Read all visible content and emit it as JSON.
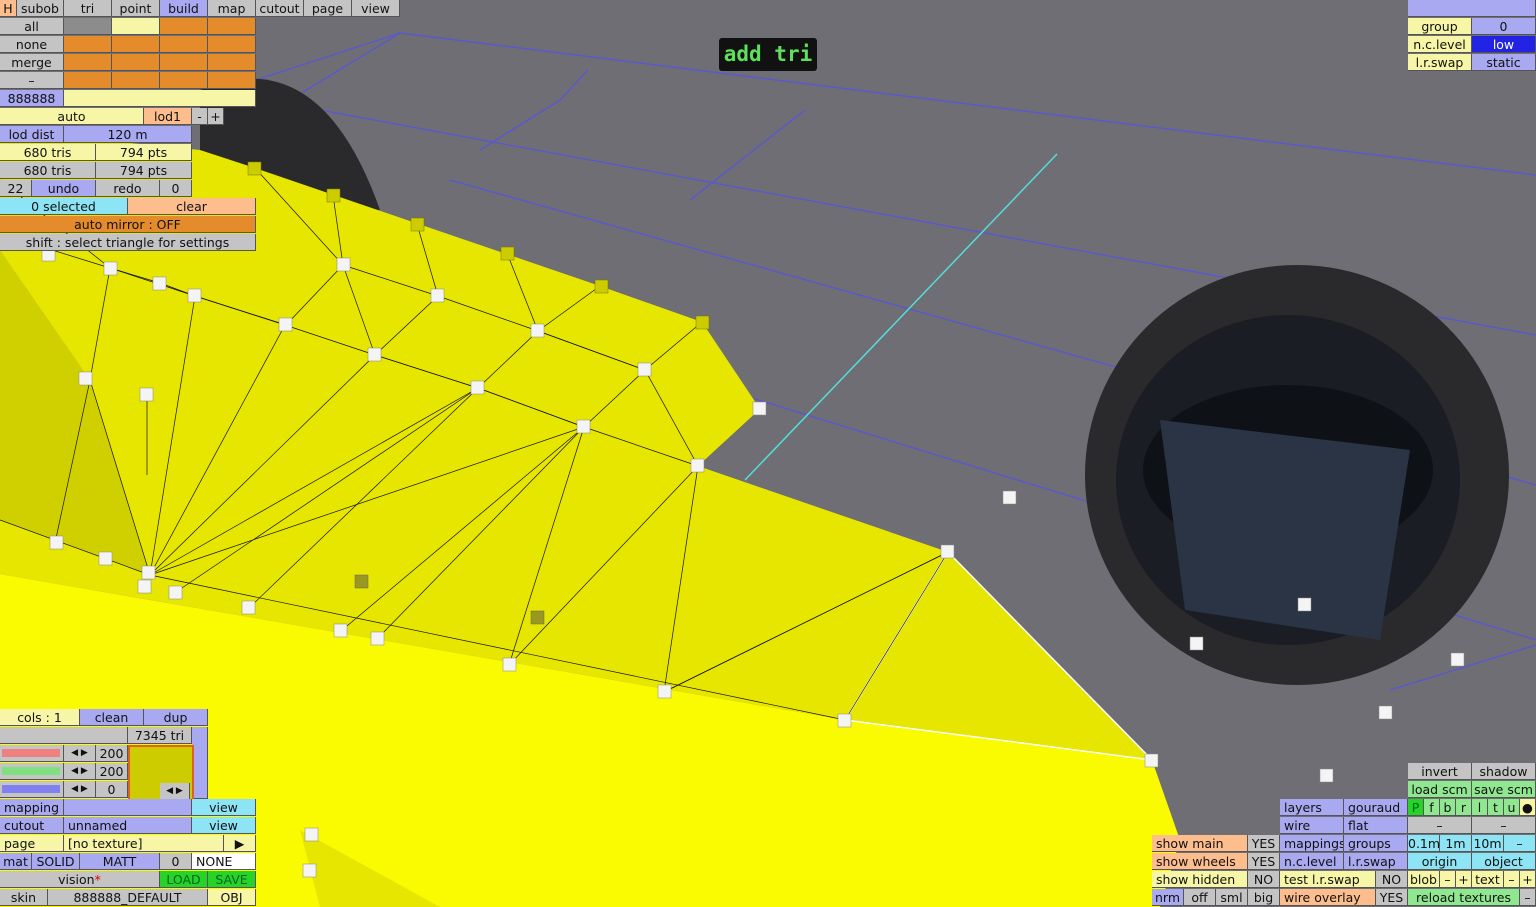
{
  "scene": {
    "bg_color": "#6e6e74",
    "mesh_color": "#e6e600",
    "handle": "vertex-handle"
  },
  "banner": "add tri",
  "tabs": {
    "h": "H",
    "subob": "subob",
    "tri": "tri",
    "point": "point",
    "build": "build",
    "map": "map",
    "cutout": "cutout",
    "page": "page",
    "view": "view"
  },
  "sel": {
    "all": "all",
    "none": "none",
    "merge": "merge",
    "dash": "–",
    "color": "888888"
  },
  "lod": {
    "auto": "auto",
    "lod1": "lod1",
    "minus": "-",
    "plus": "+",
    "dist_label": "lod dist",
    "dist_value": "120 m"
  },
  "counts": {
    "tris1": "680 tris",
    "pts1": "794 pts",
    "tris2": "680 tris",
    "pts2": "794 pts"
  },
  "undo": {
    "count": "22",
    "undo": "undo",
    "redo": "redo",
    "redo_count": "0"
  },
  "selection": {
    "status": "0 selected",
    "clear": "clear",
    "mirror": "auto mirror : OFF",
    "hint": "shift : select triangle for settings"
  },
  "topright": {
    "group_label": "group",
    "group_value": "0",
    "nc_label": "n.c.level",
    "nc_value": "low",
    "lr_label": "l.r.swap",
    "lr_value": "static"
  },
  "color_panel": {
    "cols": "cols : 1",
    "clean": "clean",
    "dup": "dup",
    "tri_count": "7345 tri",
    "v1": "200",
    "v2": "200",
    "v3": "0",
    "swatch": "#cccc00",
    "left": "◀",
    "right": "▶"
  },
  "props": {
    "mapping": "mapping",
    "cutout": "cutout",
    "cutout_name": "unnamed",
    "view": "view",
    "page": "page",
    "page_value": "[no texture]",
    "play": "▶",
    "mat": "mat",
    "solid": "SOLID",
    "matt": "MATT",
    "mat_num": "0",
    "none": "NONE",
    "vision": "vision",
    "asterisk": "*",
    "load": "LOAD",
    "save": "SAVE",
    "skin": "skin",
    "skin_value": "888888_DEFAULT",
    "obj": "OBJ"
  },
  "show": {
    "main": "show main",
    "wheels": "show wheels",
    "hidden": "show hidden",
    "yes": "YES",
    "no": "NO"
  },
  "display": {
    "nrm": "nrm",
    "off": "off",
    "sml": "sml",
    "big": "big",
    "layers": "layers",
    "gouraud": "gouraud",
    "wire": "wire",
    "flat": "flat",
    "mappings": "mappings",
    "groups": "groups",
    "nc": "n.c.level",
    "lrswap": "l.r.swap",
    "test": "test l.r.swap",
    "no": "NO",
    "wire_overlay": "wire overlay",
    "yes": "YES"
  },
  "br": {
    "invert": "invert",
    "shadow": "shadow",
    "load_scm": "load scm",
    "save_scm": "save scm",
    "flags": [
      "P",
      "f",
      "b",
      "r",
      "l",
      "t",
      "u"
    ],
    "dot": "●",
    "dash": "–",
    "m01": "0.1m",
    "m1": "1m",
    "m10": "10m",
    "origin": "origin",
    "object": "object",
    "blob": "blob",
    "text": "text",
    "minus": "–",
    "plus": "+",
    "reload": "reload textures"
  }
}
